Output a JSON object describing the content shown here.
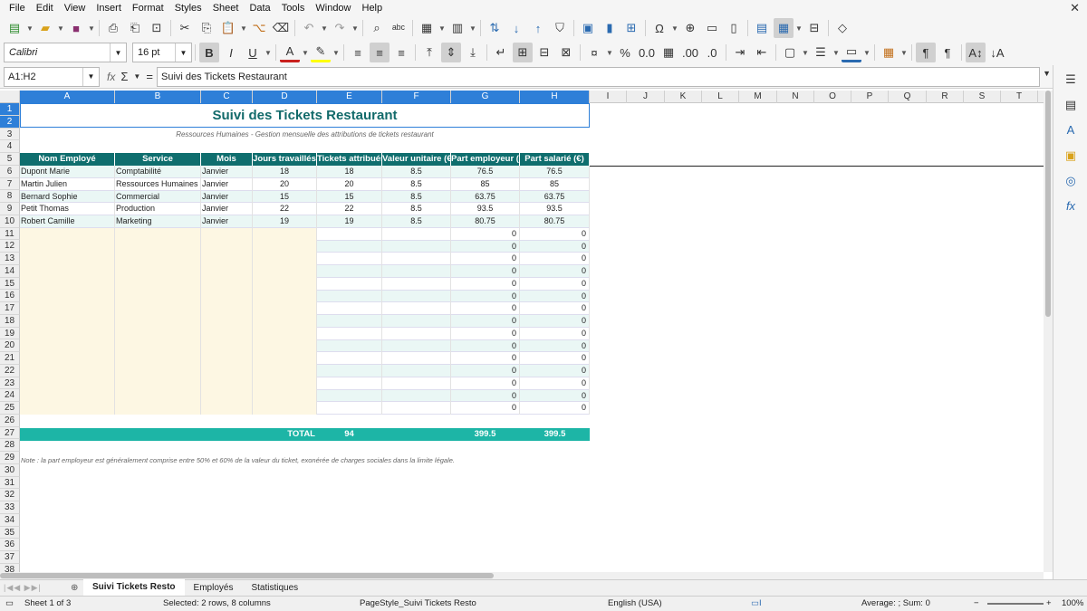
{
  "menu": [
    "File",
    "Edit",
    "View",
    "Insert",
    "Format",
    "Styles",
    "Sheet",
    "Data",
    "Tools",
    "Window",
    "Help"
  ],
  "font": {
    "name": "Calibri",
    "size": "16 pt"
  },
  "formula": {
    "cell_ref": "A1:H2",
    "content": "Suivi des Tickets Restaurant"
  },
  "columns": [
    "A",
    "B",
    "C",
    "D",
    "E",
    "F",
    "G",
    "H",
    "I",
    "J",
    "K",
    "L",
    "M",
    "N",
    "O",
    "P",
    "Q",
    "R",
    "S",
    "T"
  ],
  "rows": [
    "1",
    "2",
    "3",
    "4",
    "5",
    "6",
    "7",
    "8",
    "9",
    "10",
    "11",
    "12",
    "13",
    "14",
    "15",
    "16",
    "17",
    "18",
    "19",
    "20",
    "21",
    "22",
    "23",
    "24",
    "25",
    "26",
    "27",
    "28",
    "29",
    "30",
    "31",
    "32",
    "33",
    "34",
    "35",
    "36",
    "37",
    "38"
  ],
  "sheet": {
    "title": "Suivi des Tickets Restaurant",
    "subtitle": "Ressources Humaines - Gestion mensuelle des attributions de tickets restaurant",
    "headers": [
      "Nom Employé",
      "Service",
      "Mois",
      "Jours travaillés",
      "Tickets attribués",
      "Valeur unitaire (€)",
      "Part employeur (€)",
      "Part salarié (€)"
    ],
    "data_rows": [
      [
        "Dupont Marie",
        "Comptabilité",
        "Janvier",
        "18",
        "18",
        "8.5",
        "76.5",
        "76.5"
      ],
      [
        "Martin Julien",
        "Ressources Humaines",
        "Janvier",
        "20",
        "20",
        "8.5",
        "85",
        "85"
      ],
      [
        "Bernard Sophie",
        "Commercial",
        "Janvier",
        "15",
        "15",
        "8.5",
        "63.75",
        "63.75"
      ],
      [
        "Petit Thomas",
        "Production",
        "Janvier",
        "22",
        "22",
        "8.5",
        "93.5",
        "93.5"
      ],
      [
        "Robert Camille",
        "Marketing",
        "Janvier",
        "19",
        "19",
        "8.5",
        "80.75",
        "80.75"
      ]
    ],
    "empty_row_values": [
      "0",
      "0"
    ],
    "total": {
      "label": "TOTAL",
      "tickets": "94",
      "employer": "399.5",
      "employee": "399.5"
    },
    "note": "Note : la part employeur est généralement comprise entre 50% et 60% de la valeur du ticket, exonérée de charges sociales dans la limite légale."
  },
  "tabs": [
    "Suivi Tickets Resto",
    "Employés",
    "Statistiques"
  ],
  "status": {
    "sheet": "Sheet 1 of 3",
    "selection": "Selected: 2 rows, 8 columns",
    "page_style": "PageStyle_Suivi Tickets Resto",
    "language": "English (USA)",
    "sum": "Average: ; Sum: 0",
    "zoom": "100%"
  }
}
